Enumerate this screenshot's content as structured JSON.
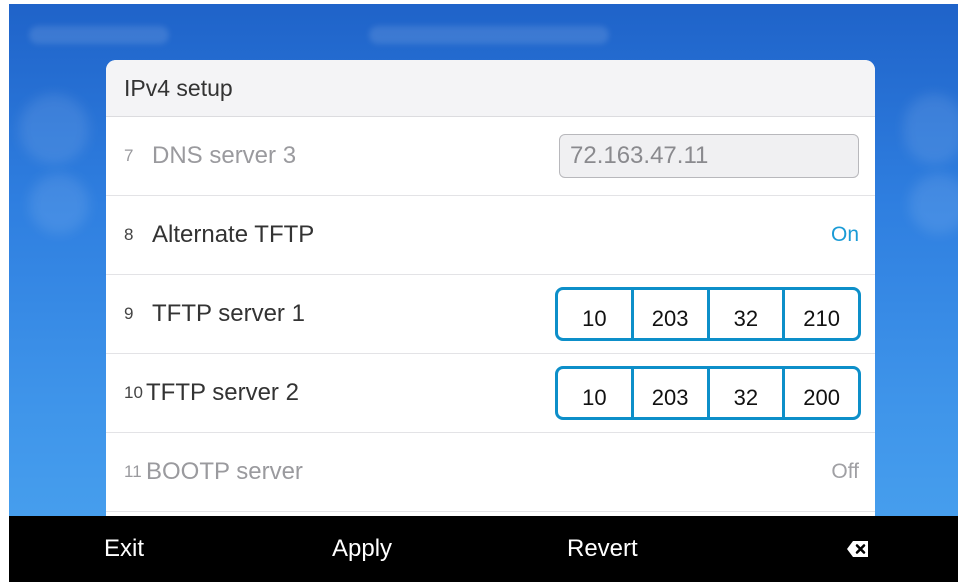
{
  "dialog": {
    "title": "IPv4 setup"
  },
  "rows": [
    {
      "number": "7",
      "label": "DNS server 3",
      "value": "72.163.47.11"
    },
    {
      "number": "8",
      "label": "Alternate TFTP",
      "value": "On"
    },
    {
      "number": "9",
      "label": "TFTP server 1",
      "octets": [
        "10",
        "203",
        "32",
        "210"
      ]
    },
    {
      "number": "10",
      "label": "TFTP server 2",
      "octets": [
        "10",
        "203",
        "32",
        "200"
      ]
    },
    {
      "number": "11",
      "label": "BOOTP server",
      "value": "Off"
    }
  ],
  "softkeys": {
    "exit": "Exit",
    "apply": "Apply",
    "revert": "Revert",
    "backspace_icon": "backspace-icon"
  },
  "colors": {
    "accent": "#0d8fc9",
    "on_text": "#1a9bd6",
    "background_blue": "#2f7fe0"
  }
}
